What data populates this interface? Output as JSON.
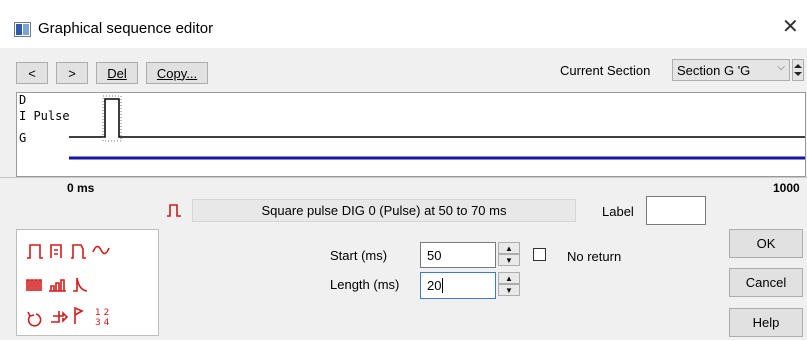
{
  "window": {
    "title": "Graphical sequence editor",
    "close_glyph": "✕"
  },
  "toolbar": {
    "prev_label": "<",
    "next_label": ">",
    "del_label": "Del",
    "copy_label": "Copy...",
    "current_section_label": "Current Section",
    "current_section_value": "Section G 'G"
  },
  "sequence": {
    "channels": [
      "D",
      "I Pulse",
      "G"
    ],
    "axis_start": "0 ms",
    "axis_end": "1000",
    "colors": {
      "blue_line": "#1515a8",
      "pulse_line": "#000000"
    }
  },
  "item": {
    "description": "Square pulse DIG 0 (Pulse) at 50 to 70 ms",
    "label_caption": "Label",
    "label_value": ""
  },
  "palette": {
    "icons": [
      [
        "square-pulse-icon",
        "pulse-train-icon",
        "ramp-pulse-icon",
        "sine-wave-icon"
      ],
      [
        "multi-pulse-icon",
        "stepped-pulse-icon",
        "exp-decay-icon"
      ],
      [
        "loop-icon",
        "branch-icon",
        "marker-flag-icon",
        "table-values-icon"
      ]
    ],
    "accent": "#d21b1b"
  },
  "params": {
    "start_label": "Start (ms)",
    "start_value": "50",
    "length_label": "Length (ms)",
    "length_value": "20",
    "no_return_label": "No return",
    "no_return_checked": false
  },
  "actions": {
    "ok_label": "OK",
    "cancel_label": "Cancel",
    "help_label": "Help"
  }
}
